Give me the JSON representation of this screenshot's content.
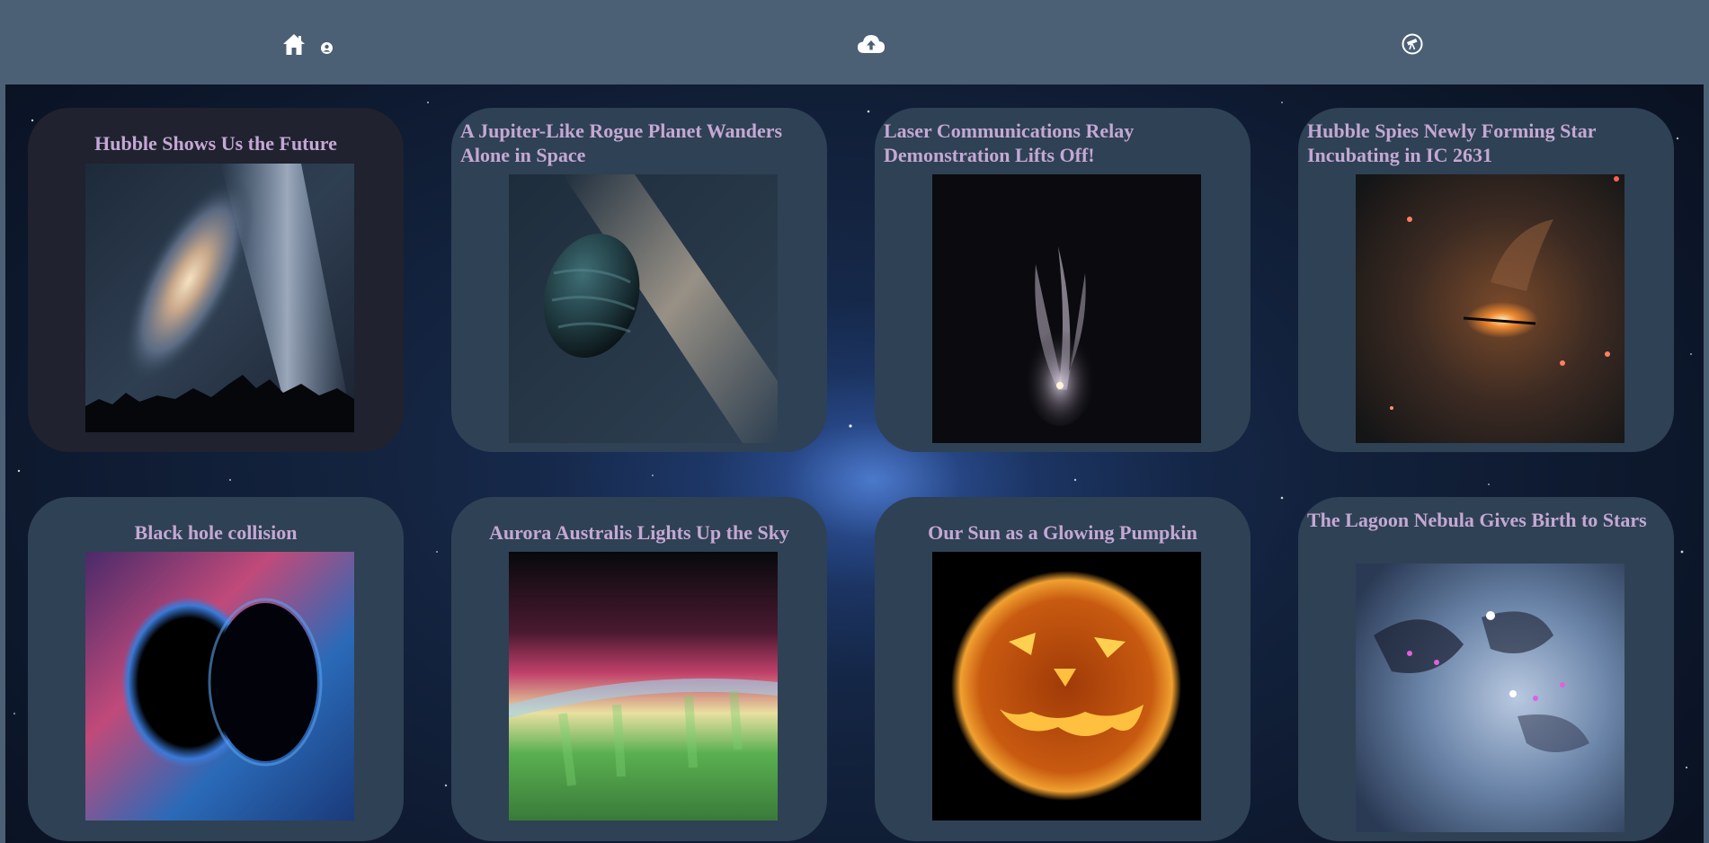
{
  "nav": {
    "home_icon": "home-icon",
    "user_icon": "user-circle-icon",
    "upload_icon": "cloud-upload-icon",
    "telescope_icon": "telescope-icon"
  },
  "colors": {
    "header_bg": "#4b6075",
    "card_bg": "#2f4154",
    "card_bg_highlight": "#20222f",
    "title_color": "#c4a8d4"
  },
  "cards": [
    {
      "title": "Hubble Shows Us the Future",
      "image": "milky-way-andromeda-image"
    },
    {
      "title": "A Jupiter-Like Rogue Planet Wanders Alone in Space",
      "image": "rogue-planet-image"
    },
    {
      "title": "Laser Communications Relay Demonstration Lifts Off!",
      "image": "rocket-launch-image"
    },
    {
      "title": "Hubble Spies Newly Forming Star Incubating in IC 2631",
      "image": "forming-star-image"
    },
    {
      "title": "Black hole collision",
      "image": "black-hole-collision-image"
    },
    {
      "title": "Aurora Australis Lights Up the Sky",
      "image": "aurora-image"
    },
    {
      "title": "Our Sun as a Glowing Pumpkin",
      "image": "sun-pumpkin-image"
    },
    {
      "title": "The Lagoon Nebula Gives Birth to Stars",
      "image": "lagoon-nebula-image"
    }
  ]
}
